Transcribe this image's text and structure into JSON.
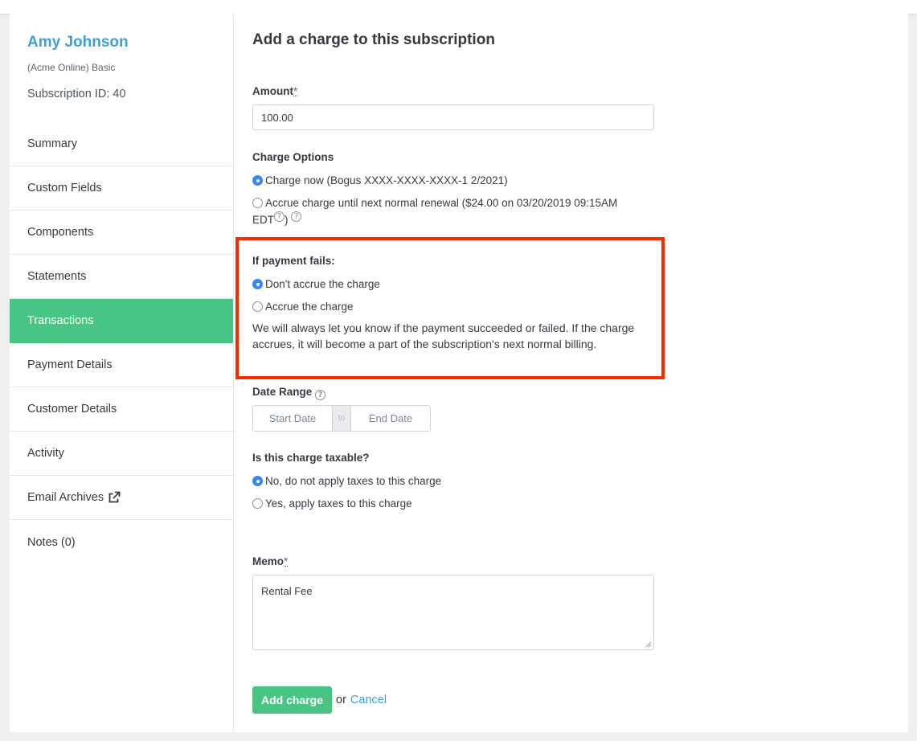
{
  "customer": {
    "name": "Amy Johnson",
    "plan": "(Acme Online) Basic",
    "subscription_id": "Subscription ID: 40"
  },
  "nav": {
    "items": [
      {
        "label": "Summary"
      },
      {
        "label": "Custom Fields"
      },
      {
        "label": "Components"
      },
      {
        "label": "Statements"
      },
      {
        "label": "Transactions",
        "active": true
      },
      {
        "label": "Payment Details"
      },
      {
        "label": "Customer Details"
      },
      {
        "label": "Activity"
      },
      {
        "label": "Email Archives",
        "icon": "external-link-icon"
      },
      {
        "label": "Notes (0)"
      }
    ]
  },
  "form": {
    "title": "Add a charge to this subscription",
    "amount": {
      "label": "Amount",
      "required_mark": "*",
      "value": "100.00"
    },
    "charge_options": {
      "label": "Charge Options",
      "option_now": "Charge now (Bogus XXXX-XXXX-XXXX-1 2/2021)",
      "option_accrue_line1": "Accrue charge until next normal renewal ($24.00 on 03/20/2019 09:15AM",
      "option_accrue_line2": "EDT",
      "option_accrue_close": ")",
      "selected": "now"
    },
    "payment_fails": {
      "label": "If payment fails:",
      "option_dont": "Don't accrue the charge",
      "option_accrue": "Accrue the charge",
      "selected": "dont",
      "note": "We will always let you know if the payment succeeded or failed. If the charge accrues, it will become a part of the subscription's next normal billing."
    },
    "date_range": {
      "label": "Date Range",
      "start_placeholder": "Start Date",
      "separator": "to",
      "end_placeholder": "End Date"
    },
    "taxable": {
      "label": "Is this charge taxable?",
      "option_no": "No, do not apply taxes to this charge",
      "option_yes": "Yes, apply taxes to this charge",
      "selected": "no"
    },
    "memo": {
      "label": "Memo",
      "required_mark": "*",
      "value": "Rental Fee"
    },
    "submit_label": "Add charge",
    "or_text": "or",
    "cancel_label": "Cancel"
  },
  "colors": {
    "accent": "#48c585",
    "link": "#3e9ed8",
    "radio_checked": "#3b86f0",
    "highlight_border": "#fa2a00"
  },
  "icons": {
    "help": "?"
  }
}
